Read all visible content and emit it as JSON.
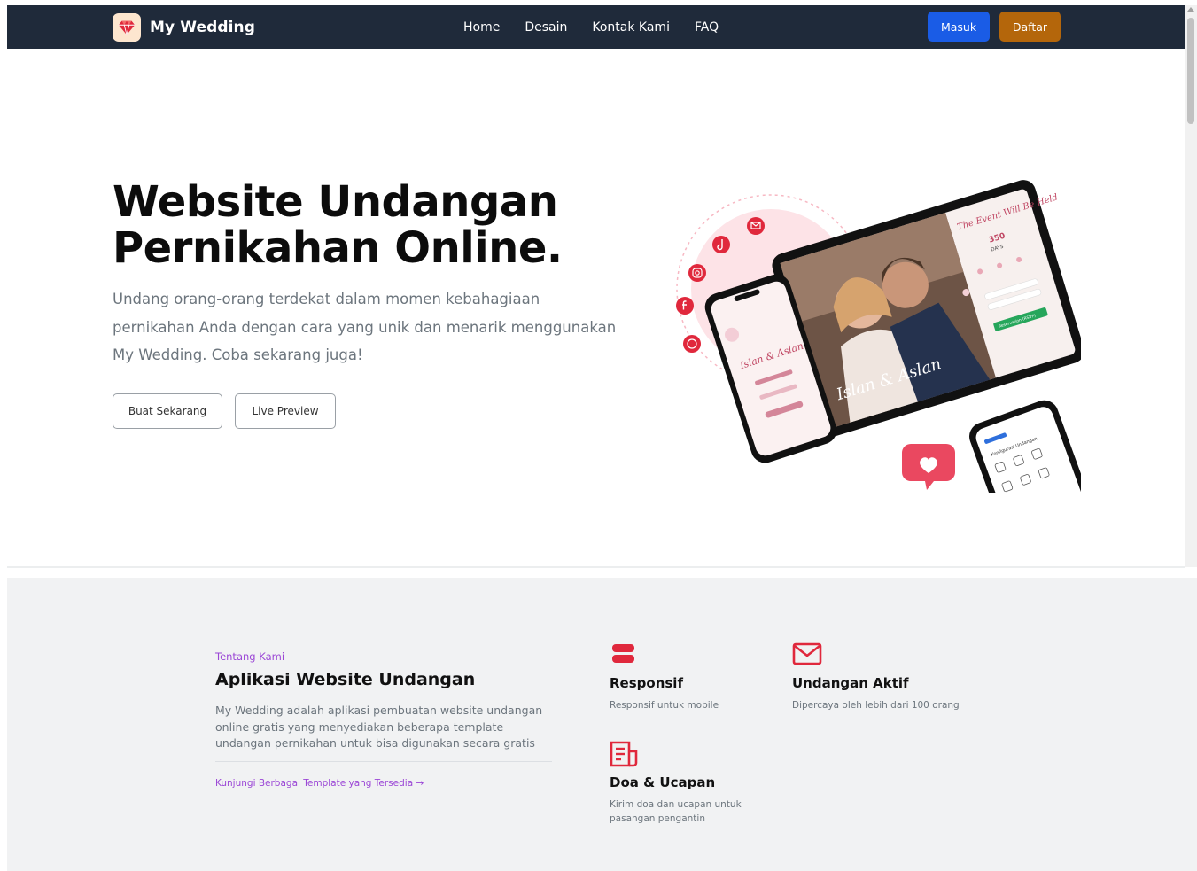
{
  "navbar": {
    "brand": "My Wedding",
    "links": [
      "Home",
      "Desain",
      "Kontak Kami",
      "FAQ"
    ],
    "login_label": "Masuk",
    "register_label": "Daftar",
    "colors": {
      "background": "#1f2a3a",
      "login": "#1a5ce6",
      "register": "#b4660b"
    }
  },
  "hero": {
    "title_line1": "Website Undangan",
    "title_line2": "Pernikahan Online.",
    "description": "Undang orang-orang terdekat dalam momen kebahagiaan pernikahan Anda dengan cara yang unik dan menarik menggunakan My Wedding. Coba sekarang juga!",
    "buttons": {
      "create": "Buat Sekarang",
      "preview": "Live Preview"
    },
    "illustration": {
      "tablet_header": "The Event Will Be Held",
      "countdown_days": "350",
      "countdown_days_label": "DAYS",
      "couple_names": "Islan & Aslan",
      "reservation_button": "Reservation (RSVP)",
      "social_icons": [
        "email-icon",
        "tiktok-icon",
        "instagram-icon",
        "facebook-icon",
        "whatsapp-icon"
      ]
    }
  },
  "about": {
    "kicker": "Tentang Kami",
    "title": "Aplikasi Website Undangan",
    "description": "My Wedding adalah aplikasi pembuatan website undangan online gratis yang menyediakan beberapa template undangan pernikahan untuk bisa digunakan secara gratis",
    "link_label": "Kunjungi Berbagai Template yang Tersedia",
    "link_arrow": "→",
    "accent_color": "#9b47d6"
  },
  "features": [
    {
      "icon": "stack-icon",
      "title": "Responsif",
      "description": "Responsif untuk mobile"
    },
    {
      "icon": "envelope-icon",
      "title": "Undangan Aktif",
      "description": "Dipercaya oleh lebih dari 100 orang"
    },
    {
      "icon": "document-icon",
      "title": "Doa & Ucapan",
      "description": "Kirim doa dan ucapan untuk pasangan pengantin"
    }
  ],
  "feature_icon_color": "#e0283c"
}
